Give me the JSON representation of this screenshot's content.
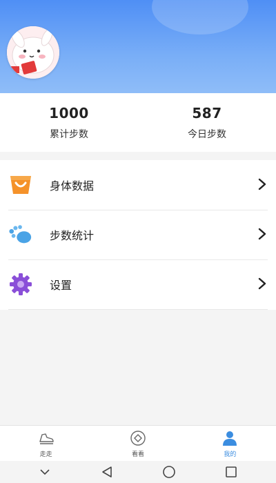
{
  "header": {
    "avatar_icon": "bunny-avatar-icon",
    "gradient_colors": [
      "#4f8ff5",
      "#8fbdf8"
    ]
  },
  "stats": {
    "total": {
      "value": "1000",
      "label": "累计步数"
    },
    "today": {
      "value": "587",
      "label": "今日步数"
    }
  },
  "menu": {
    "items": [
      {
        "label": "身体数据",
        "icon": "shopping-bag-icon",
        "icon_color": "#f5922a"
      },
      {
        "label": "步数统计",
        "icon": "footprint-icon",
        "icon_color": "#4aa3e6"
      },
      {
        "label": "设置",
        "icon": "gear-icon",
        "icon_color": "#8a4fd8"
      }
    ]
  },
  "tabbar": {
    "tabs": [
      {
        "label": "走走",
        "icon": "sneaker-icon",
        "active": false
      },
      {
        "label": "看看",
        "icon": "eye-diamond-icon",
        "active": false
      },
      {
        "label": "我的",
        "icon": "person-icon",
        "active": true
      }
    ],
    "active_color": "#3b8de0"
  },
  "system_nav": {
    "buttons": [
      "chevron-down-icon",
      "back-triangle-icon",
      "home-circle-icon",
      "recents-square-icon"
    ]
  }
}
